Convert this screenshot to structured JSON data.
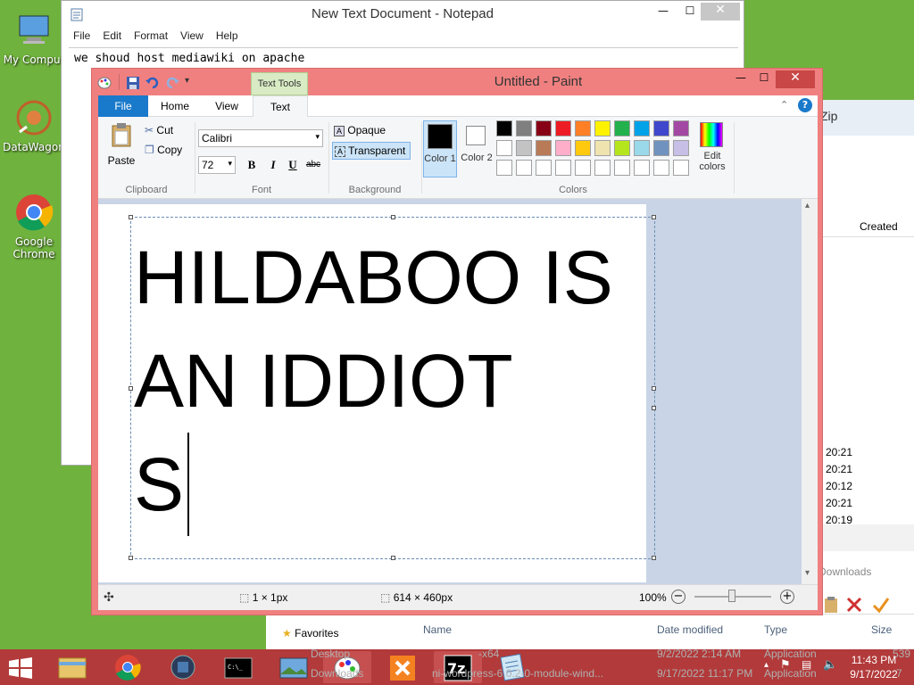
{
  "desktop": {
    "icons": [
      {
        "label": "My Comput"
      },
      {
        "label": "DataWagon"
      },
      {
        "label": "Google Chrome"
      }
    ]
  },
  "notepad": {
    "title": "New Text Document - Notepad",
    "menu": [
      "File",
      "Edit",
      "Format",
      "View",
      "Help"
    ],
    "content": "we shoud host mediawiki on apache"
  },
  "paint": {
    "title": "Untitled - Paint",
    "context_tab_group": "Text Tools",
    "tabs": [
      "File",
      "Home",
      "View",
      "Text"
    ],
    "clipboard": {
      "paste": "Paste",
      "cut": "Cut",
      "copy": "Copy",
      "label": "Clipboard"
    },
    "font": {
      "family": "Calibri",
      "size": "72",
      "label": "Font",
      "bold": "B",
      "italic": "I",
      "underline": "U",
      "strike": "abc"
    },
    "background": {
      "opaque": "Opaque",
      "transparent": "Transparent",
      "label": "Background"
    },
    "colors": {
      "color1": "Color 1",
      "color2": "Color 2",
      "label": "Colors",
      "edit": "Edit colors",
      "row1": [
        "#000000",
        "#7f7f7f",
        "#880015",
        "#ed1c24",
        "#ff7f27",
        "#fff200",
        "#22b14c",
        "#00a2e8",
        "#3f48cc",
        "#a349a4"
      ],
      "row2": [
        "#ffffff",
        "#c3c3c3",
        "#b97a57",
        "#ffaec9",
        "#ffc90e",
        "#efe4b0",
        "#b5e61d",
        "#99d9ea",
        "#7092be",
        "#c8bfe7"
      ]
    },
    "canvas_text": [
      "HILDABOO IS",
      "AN IDDIOT",
      "S"
    ],
    "status": {
      "selection": "1 × 1px",
      "size": "614 × 460px",
      "zoom": "100%"
    }
  },
  "explorer": {
    "title_fragment": "Zip",
    "col_created": "Created",
    "times": [
      "20:21",
      "20:21",
      "20:12",
      "20:21",
      "20:19"
    ],
    "downloads_fragment": "Downloads",
    "favorites": "Favorites",
    "cols": {
      "name": "Name",
      "date": "Date modified",
      "type": "Type",
      "size": "Size"
    },
    "rows": [
      {
        "name": "Desktop",
        "date": "9/2/2022 2:14 AM",
        "type": "Application",
        "size": "539"
      },
      {
        "name": "Downloads",
        "date": "9/17/2022 11:17 PM",
        "type": "Application",
        "size": "7"
      }
    ],
    "behind_text_1": "-x64",
    "behind_text_2": "ni-wordpress-6.0.2-0-module-wind..."
  },
  "taskbar": {
    "time": "11:43 PM",
    "date": "9/17/2022"
  }
}
